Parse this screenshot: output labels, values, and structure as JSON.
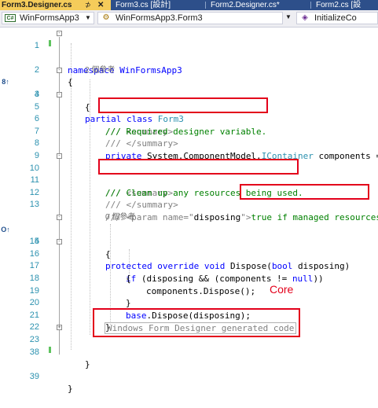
{
  "tabs": [
    {
      "label": "Form3.Designer.cs",
      "active": true
    },
    {
      "label": "Form3.cs [設計]"
    },
    {
      "label": "Form2.Designer.cs*"
    },
    {
      "label": "Form2.cs [設"
    }
  ],
  "tab_pin": "⊅",
  "tab_close": "✕",
  "navbar": {
    "project": "WinFormsApp3",
    "project_icon": "C#",
    "class": "WinFormsApp3.Form3",
    "member": "InitializeCo"
  },
  "lines": {
    "l1": {
      "num": "1",
      "t1": "namespace WinFormsApp3"
    },
    "l2": {
      "num": "2",
      "t1": "{"
    },
    "ref1": "2 個參考",
    "l3": {
      "num": "3",
      "kw": "partial class ",
      "ty": "Form3"
    },
    "l4": {
      "num": "4",
      "t1": "{"
    },
    "l5": {
      "num": "5",
      "doc": "/// <summary>"
    },
    "l6": {
      "num": "6",
      "cm": "/// Required designer variable."
    },
    "l7": {
      "num": "7",
      "doc": "/// </summary>"
    },
    "l8": {
      "num": "8",
      "kw": "private ",
      "t1": "System.ComponentModel.",
      "ty": "IContainer",
      "t2": " components ="
    },
    "l9": {
      "num": "9"
    },
    "l10": {
      "num": "10",
      "doc": "/// <summary>"
    },
    "l11": {
      "num": "11",
      "cm": "/// Clean up any resources being used."
    },
    "l12": {
      "num": "12",
      "doc": "/// </summary>"
    },
    "l13": {
      "num": "13",
      "doc1": "/// <param name=\"",
      "t1": "disposing",
      "doc2": "\">",
      "cm": "true if managed resources"
    },
    "ref2": "0 個參考",
    "l14": {
      "num": "14",
      "kw1": "protected override void ",
      "t1": "Dispose(",
      "kw2": "bool",
      "t2": " disposing)"
    },
    "l15": {
      "num": "15",
      "t1": "{"
    },
    "l16": {
      "num": "16",
      "kw1": "if",
      "t1": " (disposing && (components != ",
      "kw2": "null",
      "t2": "))"
    },
    "l17": {
      "num": "17",
      "t1": "{"
    },
    "l18": {
      "num": "18",
      "t1": "components.Dispose();"
    },
    "l19": {
      "num": "19",
      "t1": "}"
    },
    "l20": {
      "num": "20",
      "kw": "base",
      "t1": ".Dispose(disposing);"
    },
    "l21": {
      "num": "21",
      "t1": "}"
    },
    "l22": {
      "num": "22"
    },
    "l23": {
      "num": "23",
      "collapsed": "Windows Form Designer generated code"
    },
    "l38": {
      "num": "38",
      "t1": "}"
    },
    "l39": {
      "num": "39",
      "t1": "}"
    }
  },
  "margin_icons": {
    "line3": "8↑",
    "line14": "O↑"
  },
  "annotation": "Core",
  "colors": {
    "keyword": "#0000ff",
    "type": "#2b91af",
    "comment": "#008000",
    "highlight": "#e3001b",
    "active_tab": "#f5cc5a"
  }
}
